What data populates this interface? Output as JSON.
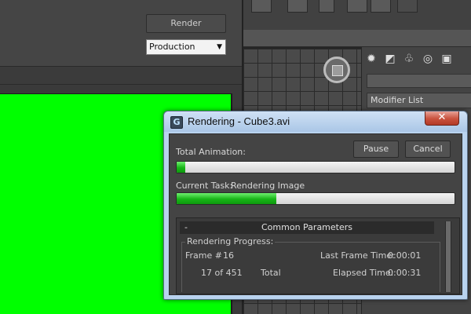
{
  "render_frame": {
    "render_label": "Render",
    "preset_value": "Production",
    "image_color": "#00ff00"
  },
  "command_panel": {
    "modifier_list_label": "Modifier List"
  },
  "dialog": {
    "title": "Rendering - Cube3.avi",
    "close_glyph": "✕",
    "total_animation_label": "Total Animation:",
    "pause_label": "Pause",
    "cancel_label": "Cancel",
    "total_progress_fraction": 0.03,
    "current_task_label": "Current Task:",
    "current_task_value": "Rendering Image",
    "task_progress_fraction": 0.36,
    "params": {
      "collapse_glyph": "-",
      "title": "Common Parameters",
      "group_title": "Rendering Progress:",
      "frame_label": "Frame #",
      "frame_value": "16",
      "frame_count_text": "17 of 451",
      "total_label": "Total",
      "last_frame_time_label": "Last Frame Time:",
      "last_frame_time_value": "0:00:01",
      "elapsed_time_label": "Elapsed Time:",
      "elapsed_time_value": "0:00:31"
    }
  },
  "colors": {
    "progress_green": "#17b517",
    "titlebar_blue": "#b9d3ef",
    "close_red": "#c9513d"
  },
  "icons": [
    "settings-icon",
    "hierarchy-icon",
    "motion-icon",
    "display-icon",
    "utilities-icon",
    "close-icon",
    "app-icon"
  ]
}
